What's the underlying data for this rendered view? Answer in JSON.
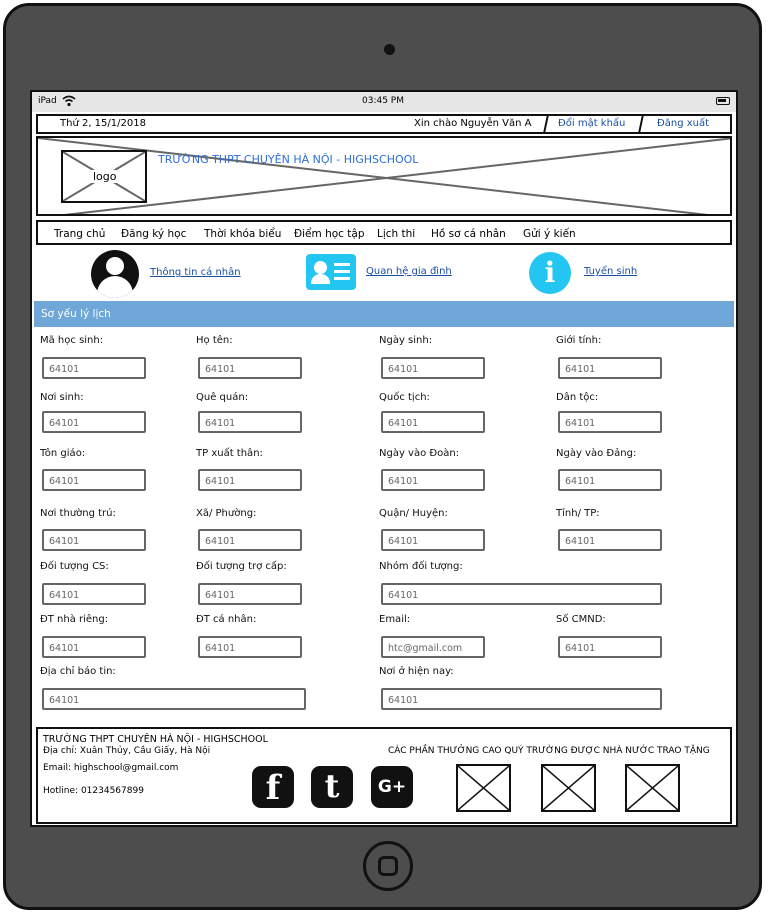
{
  "status": {
    "carrier": "iPad",
    "time": "03:45 PM"
  },
  "topbar": {
    "date": "Thứ 2, 15/1/2018",
    "greeting": "Xin chào Nguyễn Văn A",
    "change_password": "Đổi mật khẩu",
    "logout": "Đăng xuất"
  },
  "banner": {
    "logo_label": "logo",
    "school_name": "TRƯỜNG THPT CHUYÊN HÀ NỘI - HIGHSCHOOL"
  },
  "nav": [
    "Trang chủ",
    "Đăng ký học",
    "Thời khóa biểu",
    "Điểm học tập",
    "Lịch thi",
    "Hồ sơ cá nhân",
    "Gửi ý kiến"
  ],
  "quick_links": {
    "personal_info": "Thông tin cá nhân",
    "family": "Quan hệ gia đình",
    "admission": "Tuyển sinh"
  },
  "section_title": "Sơ yếu lý lịch",
  "fields": [
    {
      "label": "Mã học sinh:",
      "value": "64101"
    },
    {
      "label": "Họ tên:",
      "value": "64101"
    },
    {
      "label": "Ngày sinh:",
      "value": "64101"
    },
    {
      "label": "Giới tính:",
      "value": "64101"
    },
    {
      "label": "Nơi sinh:",
      "value": "64101"
    },
    {
      "label": "Quê quán:",
      "value": "64101"
    },
    {
      "label": "Quốc tịch:",
      "value": "64101"
    },
    {
      "label": "Dân tộc:",
      "value": "64101"
    },
    {
      "label": "Tôn giáo:",
      "value": "64101"
    },
    {
      "label": "TP xuất thân:",
      "value": "64101"
    },
    {
      "label": "Ngày vào Đoàn:",
      "value": "64101"
    },
    {
      "label": "Ngày vào Đảng:",
      "value": "64101"
    },
    {
      "label": "Nơi thường trú:",
      "value": "64101"
    },
    {
      "label": "Xã/ Phường:",
      "value": "64101"
    },
    {
      "label": "Quận/ Huyện:",
      "value": "64101"
    },
    {
      "label": "Tỉnh/ TP:",
      "value": "64101"
    },
    {
      "label": "Đối tượng CS:",
      "value": "64101"
    },
    {
      "label": "Đối tượng trợ cấp:",
      "value": "64101"
    },
    {
      "label": "Nhóm đối tượng:",
      "value": "64101"
    },
    {
      "label": "ĐT nhà riêng:",
      "value": "64101"
    },
    {
      "label": "ĐT cá nhân:",
      "value": "64101"
    },
    {
      "label": "Email:",
      "value": "htc@gmail.com"
    },
    {
      "label": "Số CMND:",
      "value": "64101"
    },
    {
      "label": "Địa chỉ báo tin:",
      "value": "64101"
    },
    {
      "label": "Nơi ở hiện nay:",
      "value": "64101"
    }
  ],
  "footer": {
    "school": "TRƯỜNG THPT CHUYÊN HÀ NỘI - HIGHSCHOOL",
    "address": "Địa chỉ: Xuân Thủy, Cầu Giấy, Hà Nội",
    "email": "Email: highschool@gmail.com",
    "hotline": "Hotline: 01234567899",
    "awards_title": "CÁC PHẦN THƯỞNG CAO QUÝ TRƯỜNG ĐƯỢC NHÀ NƯỚC TRAO TẶNG",
    "social": {
      "facebook": "f",
      "tumblr": "t",
      "google_plus": "G+"
    }
  }
}
